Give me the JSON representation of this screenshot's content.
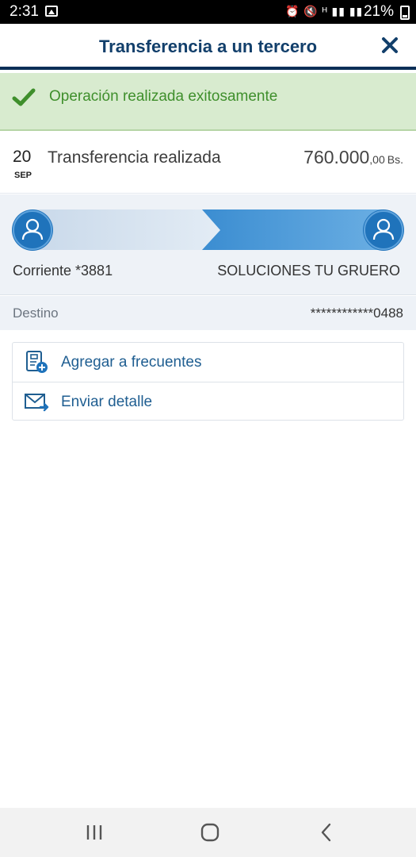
{
  "status_bar": {
    "time": "2:31",
    "icons": "⏰ 🔇 ᴴ ▮▮ ▮▮",
    "battery": "21%"
  },
  "header": {
    "title": "Transferencia a un tercero",
    "close_icon": "close-icon"
  },
  "banner": {
    "message": "Operación realizada exitosamente",
    "icon": "check-icon",
    "color": "#3f8f2c"
  },
  "transaction": {
    "day": "20",
    "month": "SEP",
    "title": "Transferencia realizada",
    "amount_main": "760.000",
    "amount_decimals": ",00",
    "currency": "Bs."
  },
  "flow": {
    "from_account": "Corriente *3881",
    "to_name": "SOLUCIONES TU GRUERO",
    "from_icon": "user-icon",
    "to_icon": "user-icon"
  },
  "destination": {
    "label": "Destino",
    "value": "************0488"
  },
  "actions": [
    {
      "label": "Agregar a frecuentes",
      "icon": "add-contact-icon"
    },
    {
      "label": "Enviar detalle",
      "icon": "send-mail-icon"
    }
  ],
  "colors": {
    "primary": "#123f6b",
    "accent": "#2f80c5",
    "success_bg": "#d8ebcf"
  }
}
